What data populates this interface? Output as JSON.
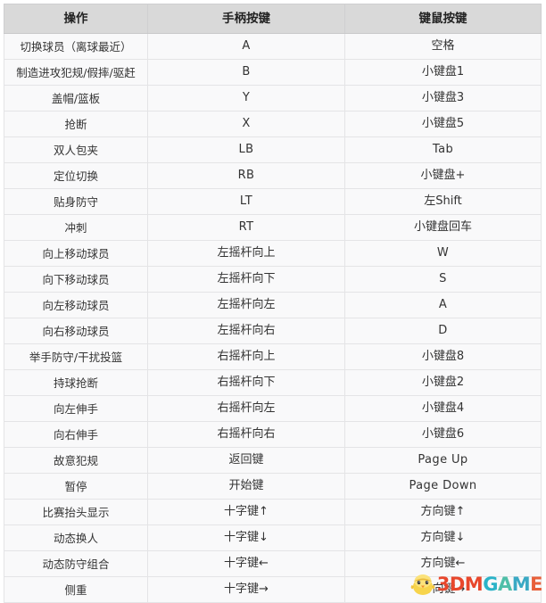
{
  "table": {
    "headers": [
      "操作",
      "手柄按键",
      "键鼠按键"
    ],
    "rows": [
      {
        "action": "切换球员（离球最近）",
        "pad": "A",
        "kbm": "空格"
      },
      {
        "action": "制造进攻犯规/假摔/驱赶",
        "pad": "B",
        "kbm": "小键盘1"
      },
      {
        "action": "盖帽/篮板",
        "pad": "Y",
        "kbm": "小键盘3"
      },
      {
        "action": "抢断",
        "pad": "X",
        "kbm": "小键盘5"
      },
      {
        "action": "双人包夹",
        "pad": "LB",
        "kbm": "Tab"
      },
      {
        "action": "定位切换",
        "pad": "RB",
        "kbm": "小键盘+"
      },
      {
        "action": "贴身防守",
        "pad": "LT",
        "kbm": "左Shift"
      },
      {
        "action": "冲刺",
        "pad": "RT",
        "kbm": "小键盘回车"
      },
      {
        "action": "向上移动球员",
        "pad": "左摇杆向上",
        "kbm": "W"
      },
      {
        "action": "向下移动球员",
        "pad": "左摇杆向下",
        "kbm": "S"
      },
      {
        "action": "向左移动球员",
        "pad": "左摇杆向左",
        "kbm": "A"
      },
      {
        "action": "向右移动球员",
        "pad": "左摇杆向右",
        "kbm": "D"
      },
      {
        "action": "举手防守/干扰投篮",
        "pad": "右摇杆向上",
        "kbm": "小键盘8"
      },
      {
        "action": "持球抢断",
        "pad": "右摇杆向下",
        "kbm": "小键盘2"
      },
      {
        "action": "向左伸手",
        "pad": "右摇杆向左",
        "kbm": "小键盘4"
      },
      {
        "action": "向右伸手",
        "pad": "右摇杆向右",
        "kbm": "小键盘6"
      },
      {
        "action": "故意犯规",
        "pad": "返回键",
        "kbm": "Page Up"
      },
      {
        "action": "暂停",
        "pad": "开始键",
        "kbm": "Page Down"
      },
      {
        "action": "比赛抬头显示",
        "pad": "十字键↑",
        "kbm": "方向键↑"
      },
      {
        "action": "动态换人",
        "pad": "十字键↓",
        "kbm": "方向键↓"
      },
      {
        "action": "动态防守组合",
        "pad": "十字键←",
        "kbm": "方向键←"
      },
      {
        "action": "侧重",
        "pad": "十字键→",
        "kbm": "方向键→"
      }
    ]
  },
  "watermark": {
    "part1": "3DM",
    "part2": "G",
    "part3": "A",
    "part4": "M",
    "part5": "E",
    "icon": "chick-mascot-icon",
    "colors": {
      "red": "#e8472c",
      "teal": "#2bb3c8",
      "green": "#4fbfa8",
      "orange": "#e8603a"
    }
  },
  "colors": {
    "header_bg": "#d9d9d9",
    "row_bg": "#f9f9fa",
    "border": "#e4e4e6",
    "text": "#333333"
  }
}
